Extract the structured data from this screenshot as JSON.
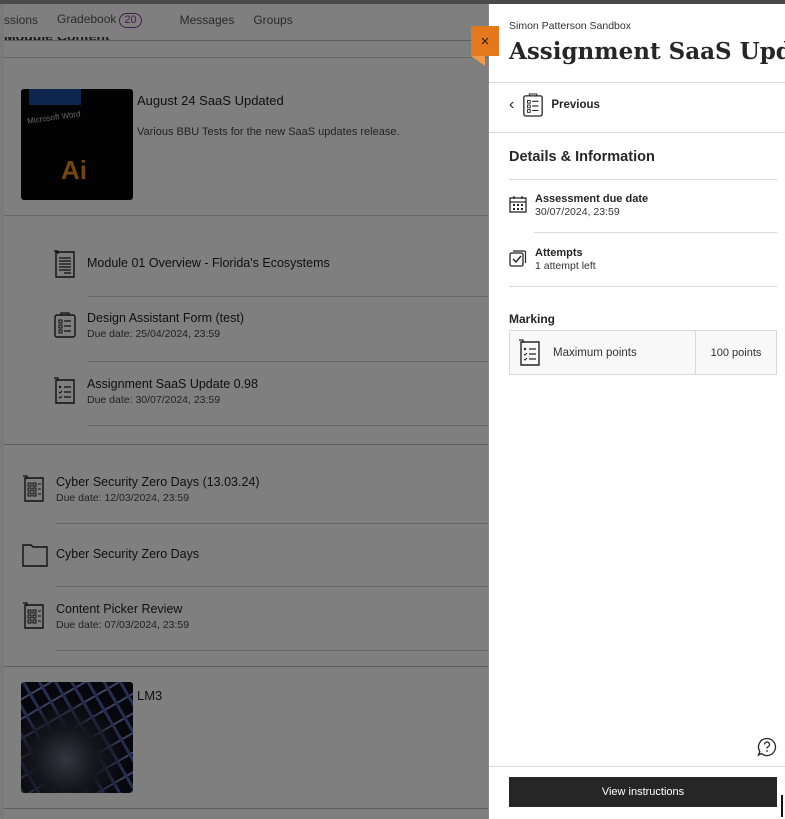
{
  "course_nav": {
    "items": [
      {
        "label": "ssions"
      },
      {
        "label": "Gradebook",
        "badge": "20"
      },
      {
        "label": "Messages"
      },
      {
        "label": "Groups"
      }
    ]
  },
  "module_heading": "Module Content",
  "background_items": {
    "module_card": {
      "title": "August 24 SaaS Updated",
      "description": "Various BBU Tests for the new SaaS updates release.",
      "thumbnail_text_1": "Microsoft Word",
      "thumbnail_text_2": "Ai"
    },
    "nested_items": [
      {
        "icon": "document-icon",
        "title": "Module 01 Overview - Florida's Ecosystems",
        "due": ""
      },
      {
        "icon": "form-icon",
        "title": "Design Assistant Form (test)",
        "due": "Due date: 25/04/2024, 23:59"
      },
      {
        "icon": "assignment-icon",
        "title": "Assignment SaaS Update 0.98",
        "due": "Due date: 30/07/2024, 23:59"
      }
    ],
    "top_items": [
      {
        "icon": "test-icon",
        "title": "Cyber Security Zero Days (13.03.24)",
        "due": "Due date: 12/03/2024, 23:59"
      },
      {
        "icon": "folder-icon",
        "title": "Cyber Security Zero Days",
        "due": ""
      },
      {
        "icon": "test-icon",
        "title": "Content Picker Review",
        "due": "Due date: 07/03/2024, 23:59"
      }
    ],
    "lm_card": {
      "title": "LM3"
    }
  },
  "panel": {
    "close_label": "×",
    "course_name": "Simon Patterson Sandbox",
    "title": "Assignment SaaS Upda...",
    "previous_label": "Previous",
    "section_title": "Details & Information",
    "due_date": {
      "label": "Assessment due date",
      "value": "30/07/2024, 23:59"
    },
    "attempts": {
      "label": "Attempts",
      "value": "1 attempt left"
    },
    "marking": {
      "label": "Marking",
      "row_label": "Maximum points",
      "row_value": "100 points"
    },
    "view_instructions_label": "View instructions"
  },
  "colors": {
    "accent_orange": "#e4781d",
    "badge_purple": "#8a3a9c",
    "button_dark": "#262626"
  }
}
